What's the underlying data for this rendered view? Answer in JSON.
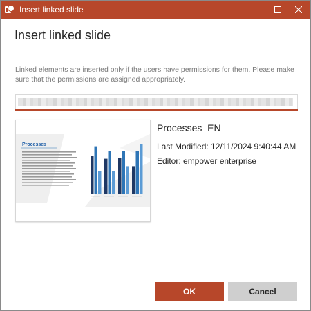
{
  "window": {
    "title": "Insert linked slide",
    "accent_color": "#b7472a"
  },
  "dialog": {
    "heading": "Insert linked slide",
    "info_text": "Linked elements are inserted only if the users have permissions for them. Please make sure that the permissions are assigned appropriately."
  },
  "search": {
    "value_blurred": true
  },
  "slide": {
    "thumbnail_title": "Processes",
    "name": "Processes_EN",
    "last_modified": "Last Modified: 12/11/2024 9:40:44 AM",
    "editor": "Editor: empower enterprise",
    "thumbnail_chart": {
      "type": "bar",
      "series_colors": [
        "#1f3864",
        "#2e75b6",
        "#5b9bd5"
      ],
      "groups": [
        [
          0.75,
          0.95,
          0.45
        ],
        [
          0.7,
          0.85,
          0.45
        ],
        [
          0.72,
          0.85,
          0.55
        ],
        [
          0.55,
          0.85,
          1.0
        ]
      ]
    }
  },
  "buttons": {
    "ok_label": "OK",
    "cancel_label": "Cancel"
  },
  "icons": {
    "app": "powerpoint-icon",
    "minimize": "minimize-icon",
    "maximize": "maximize-icon",
    "close": "close-icon"
  }
}
